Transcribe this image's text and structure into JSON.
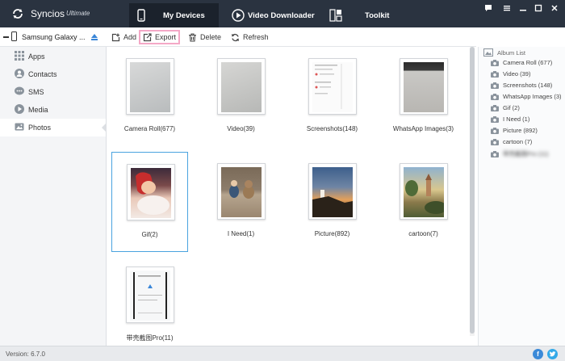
{
  "app": {
    "name": "Syncios",
    "edition": "Ultimate"
  },
  "nav": {
    "tabs": [
      {
        "label": "My Devices",
        "icon": "phone-icon",
        "active": true
      },
      {
        "label": "Video Downloader",
        "icon": "play-circle-icon",
        "active": false
      },
      {
        "label": "Toolkit",
        "icon": "toolkit-grid-icon",
        "active": false
      }
    ]
  },
  "window_controls": [
    "chat-icon",
    "menu-icon",
    "minimize-icon",
    "maximize-icon",
    "close-icon"
  ],
  "device": {
    "name": "Samsung Galaxy ..."
  },
  "sidebar": {
    "items": [
      {
        "label": "Apps",
        "icon": "apps-grid-icon",
        "active": false
      },
      {
        "label": "Contacts",
        "icon": "contacts-icon",
        "active": false
      },
      {
        "label": "SMS",
        "icon": "sms-icon",
        "active": false
      },
      {
        "label": "Media",
        "icon": "media-icon",
        "active": false
      },
      {
        "label": "Photos",
        "icon": "photos-icon",
        "active": true
      }
    ]
  },
  "toolbar": {
    "add_label": "Add",
    "export_label": "Export",
    "delete_label": "Delete",
    "refresh_label": "Refresh"
  },
  "albums": [
    {
      "label": "Camera Roll(677)",
      "selected": false
    },
    {
      "label": "Video(39)",
      "selected": false
    },
    {
      "label": "Screenshots(148)",
      "selected": false
    },
    {
      "label": "WhatsApp Images(3)",
      "selected": false
    },
    {
      "label": "Gif(2)",
      "selected": true
    },
    {
      "label": "I Need(1)",
      "selected": false
    },
    {
      "label": "Picture(892)",
      "selected": false
    },
    {
      "label": "cartoon(7)",
      "selected": false
    },
    {
      "label": "带壳截图Pro(11)",
      "selected": false
    }
  ],
  "album_list": {
    "title": "Album List",
    "items": [
      "Camera Roll (677)",
      "Video (39)",
      "Screenshots (148)",
      "WhatsApp Images (3)",
      "Gif (2)",
      "I Need (1)",
      "Picture (892)",
      "cartoon (7)",
      "带壳截图Pro (11)"
    ]
  },
  "status": {
    "version": "Version: 6.7.0"
  },
  "colors": {
    "titlebar": "#2a3340",
    "accent": "#3a86d8",
    "selection": "#4aa3df",
    "export_highlight": "#f4a8c6",
    "facebook": "#3b8ad8",
    "twitter": "#33a9e8"
  }
}
